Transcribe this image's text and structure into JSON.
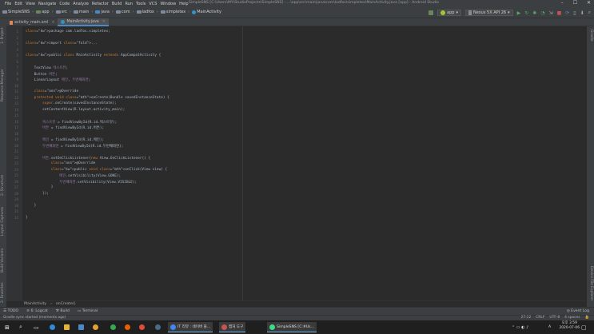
{
  "window": {
    "title": "SimpleSNS [C:\\Users\\MY\\StudioProjects\\SimpleSNS] - ...\\app\\src\\main\\java\\com\\ladfox\\simpletex\\MainActivity.java [app] - Android Studio",
    "menu": [
      "File",
      "Edit",
      "View",
      "Navigate",
      "Code",
      "Analyze",
      "Refactor",
      "Build",
      "Run",
      "Tools",
      "VCS",
      "Window",
      "Help"
    ]
  },
  "breadcrumbs": [
    "SimpleSNS",
    "app",
    "src",
    "main",
    "java",
    "com",
    "ladfox",
    "simpletex",
    "MainActivity"
  ],
  "run_config": {
    "module": "app",
    "device": "Nexus 5X API 26"
  },
  "tabs": [
    {
      "label": "activity_main.xml",
      "active": false
    },
    {
      "label": "MainActivity.java",
      "active": true
    }
  ],
  "left_tools": [
    "1: Project",
    "Resource Manager",
    "2: Structure",
    "Layout Captures",
    "Build Variants",
    "2: Favorites"
  ],
  "right_tools": [
    "Gradle",
    "Device File Explorer"
  ],
  "code_lines": [
    {
      "n": "1",
      "t": "package com.ladfox.simpletex;"
    },
    {
      "n": "2",
      "t": ""
    },
    {
      "n": "3",
      "t": "import ..."
    },
    {
      "n": "4",
      "t": ""
    },
    {
      "n": "5",
      "t": "public class MainActivity extends AppCompatActivity {"
    },
    {
      "n": "6",
      "t": ""
    },
    {
      "n": "7",
      "t": "    TextView 텍스트뷰;"
    },
    {
      "n": "8",
      "t": "    Button 버튼;"
    },
    {
      "n": "9",
      "t": "    LinearLayout 메인, 두번째화면;"
    },
    {
      "n": "10",
      "t": ""
    },
    {
      "n": "11",
      "t": "    @Override"
    },
    {
      "n": "12",
      "t": "    protected void onCreate(Bundle savedInstanceState) {"
    },
    {
      "n": "13",
      "t": "        super.onCreate(savedInstanceState);"
    },
    {
      "n": "14",
      "t": "        setContentView(R.layout.activity_main);"
    },
    {
      "n": "15",
      "t": ""
    },
    {
      "n": "16",
      "t": "        텍스트뷰 = findViewById(R.id.텍스트뷰);"
    },
    {
      "n": "17",
      "t": "        버튼 = findViewById(R.id.버튼);"
    },
    {
      "n": "18",
      "t": ""
    },
    {
      "n": "19",
      "t": "        메인 = findViewById(R.id.메인);"
    },
    {
      "n": "20",
      "t": "        두번째화면 = findViewById(R.id.두번째화면);"
    },
    {
      "n": "21",
      "t": ""
    },
    {
      "n": "22",
      "t": "        버튼.setOnClickListener(new View.OnClickListener() {"
    },
    {
      "n": "23",
      "t": "            @Override"
    },
    {
      "n": "24",
      "t": "            public void onClick(View view) {"
    },
    {
      "n": "25",
      "t": "                메인.setVisibility(View.GONE);"
    },
    {
      "n": "26",
      "t": "                두번째화면.setVisibility(View.VISIBLE);"
    },
    {
      "n": "27",
      "t": "            }"
    },
    {
      "n": "28",
      "t": "        });"
    },
    {
      "n": "29",
      "t": ""
    },
    {
      "n": "30",
      "t": "    }"
    },
    {
      "n": "31",
      "t": ""
    },
    {
      "n": "32",
      "t": "}"
    }
  ],
  "editor_breadcrumb": [
    "MainActivity",
    "onCreate()"
  ],
  "tool_windows": [
    "TODO",
    "6: Logcat",
    "Build",
    "Terminal"
  ],
  "status": {
    "message": "Gradle sync started (moments ago)",
    "position": "27:12",
    "line_sep": "CRLF",
    "encoding": "UTF-8",
    "indent": "4 spaces",
    "event_log": "Event Log"
  },
  "taskbar": {
    "items": [
      "IT 리뷰 : 네이버 블...",
      "캡처 도구",
      "SimpleSNS [C:#Us..."
    ],
    "time": "오후 3:59",
    "date": "2020-07-06",
    "ime": "A"
  },
  "colors": {
    "keyword": "#cc7832",
    "annotation": "#bbb529",
    "field": "#9876aa",
    "method": "#ffc66d",
    "text": "#a9b7c6",
    "accent": "#4a88c7"
  }
}
